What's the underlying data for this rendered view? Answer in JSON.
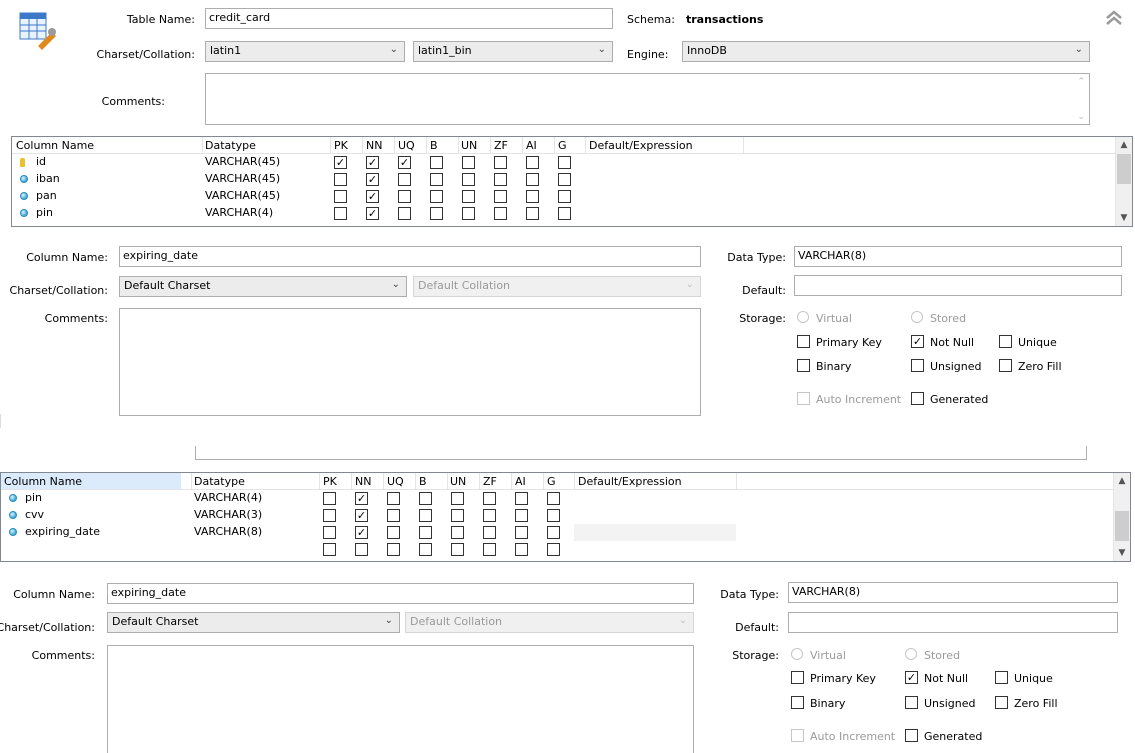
{
  "table": {
    "name_label": "Table Name:",
    "name_value": "credit_card",
    "schema_label": "Schema:",
    "schema_value": "transactions",
    "charset_label": "Charset/Collation:",
    "charset_value": "latin1",
    "collation_value": "latin1_bin",
    "engine_label": "Engine:",
    "engine_value": "InnoDB",
    "comments_label": "Comments:"
  },
  "grid_headers": [
    "Column Name",
    "Datatype",
    "PK",
    "NN",
    "UQ",
    "B",
    "UN",
    "ZF",
    "AI",
    "G",
    "Default/Expression"
  ],
  "grid1": {
    "rows": [
      {
        "icon": "key-icon",
        "name": "id",
        "type": "VARCHAR(45)",
        "flags": [
          true,
          true,
          true,
          false,
          false,
          false,
          false,
          false
        ]
      },
      {
        "icon": "column-icon",
        "name": "iban",
        "type": "VARCHAR(45)",
        "flags": [
          false,
          true,
          false,
          false,
          false,
          false,
          false,
          false
        ]
      },
      {
        "icon": "column-icon",
        "name": "pan",
        "type": "VARCHAR(45)",
        "flags": [
          false,
          true,
          false,
          false,
          false,
          false,
          false,
          false
        ]
      },
      {
        "icon": "column-icon",
        "name": "pin",
        "type": "VARCHAR(4)",
        "flags": [
          false,
          true,
          false,
          false,
          false,
          false,
          false,
          false
        ]
      }
    ]
  },
  "grid2": {
    "rows": [
      {
        "icon": "column-icon",
        "name": "pin",
        "type": "VARCHAR(4)",
        "flags": [
          false,
          true,
          false,
          false,
          false,
          false,
          false,
          false
        ]
      },
      {
        "icon": "column-icon",
        "name": "cvv",
        "type": "VARCHAR(3)",
        "flags": [
          false,
          true,
          false,
          false,
          false,
          false,
          false,
          false
        ]
      },
      {
        "icon": "column-icon",
        "name": "expiring_date",
        "type": "VARCHAR(8)",
        "flags": [
          false,
          true,
          false,
          false,
          false,
          false,
          false,
          false
        ]
      },
      {
        "icon": "",
        "name": "",
        "type": "",
        "flags": [
          false,
          false,
          false,
          false,
          false,
          false,
          false,
          false
        ]
      }
    ]
  },
  "column": {
    "name_label": "Column Name:",
    "name_value": "expiring_date",
    "charset_label": "Charset/Collation:",
    "charset_value": "Default Charset",
    "collation_value": "Default Collation",
    "comments_label": "Comments:",
    "datatype_label": "Data Type:",
    "datatype_value": "VARCHAR(8)",
    "default_label": "Default:",
    "default_value": "",
    "storage_label": "Storage:",
    "virtual": "Virtual",
    "stored": "Stored",
    "primary_key": "Primary Key",
    "not_null": "Not Null",
    "unique": "Unique",
    "binary": "Binary",
    "unsigned": "Unsigned",
    "zero_fill": "Zero Fill",
    "auto_increment": "Auto Increment",
    "generated": "Generated",
    "not_null_checked": true
  },
  "icons": {
    "table": "table-edit-icon",
    "collapse": "collapse-icon"
  }
}
